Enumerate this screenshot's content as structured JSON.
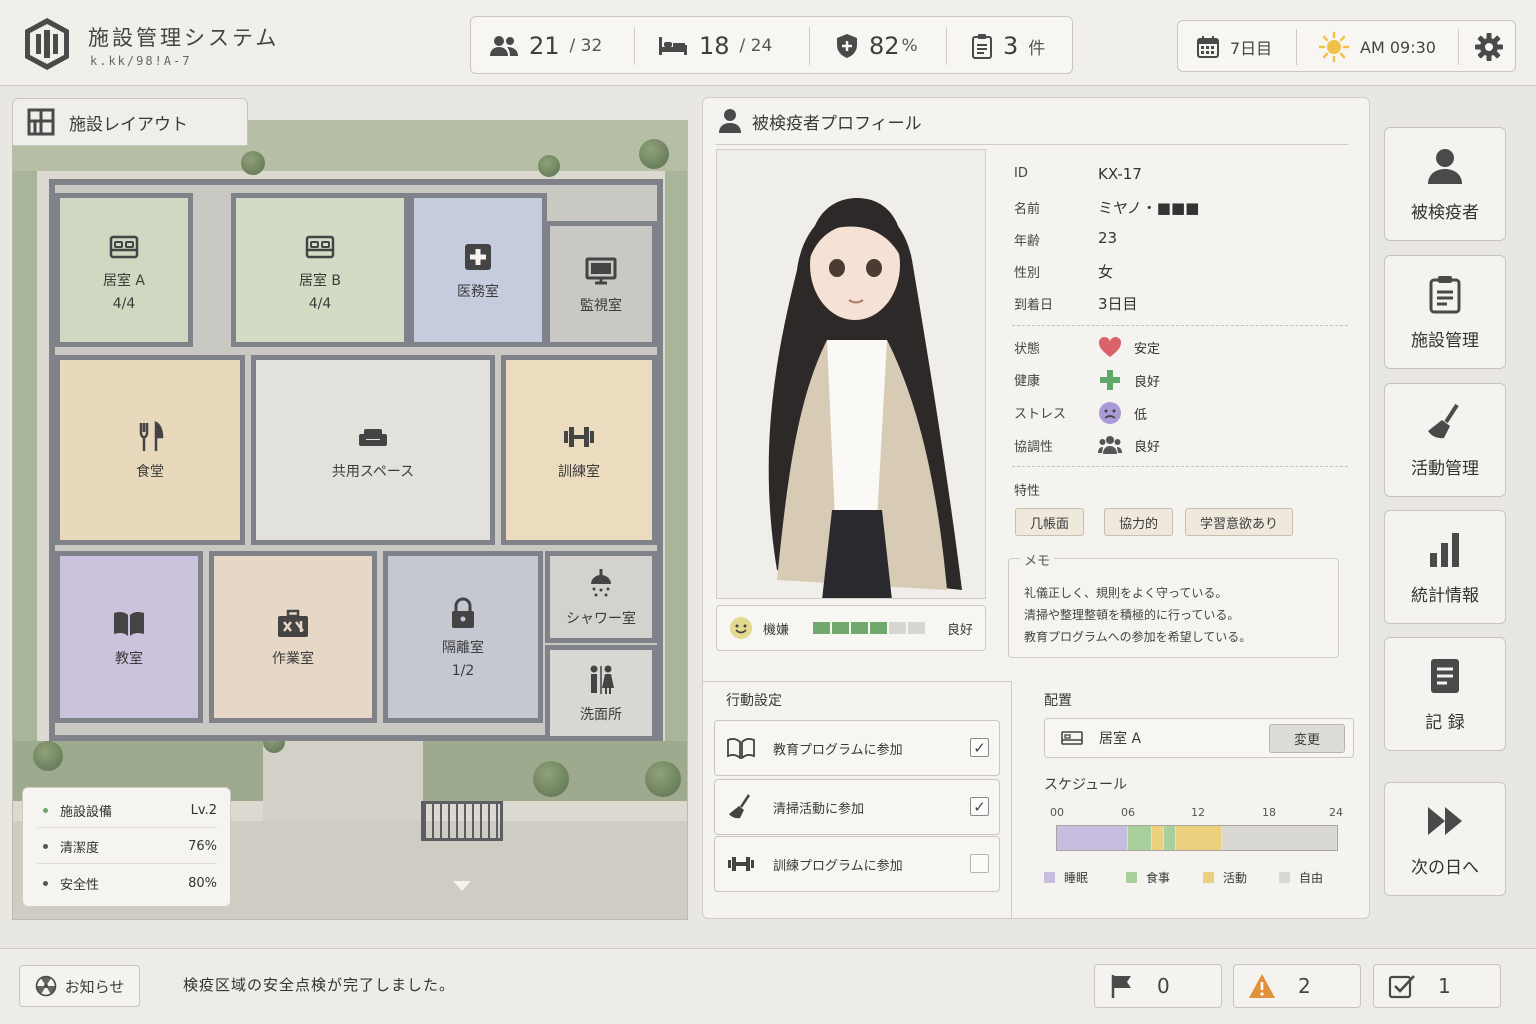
{
  "header": {
    "title": "施設管理システム",
    "subtitle": "k.kk/98!A-7",
    "stats": [
      {
        "icon": "people-icon",
        "value": "21",
        "total": "/ 32"
      },
      {
        "icon": "bed-icon",
        "value": "18",
        "total": "/ 24"
      },
      {
        "icon": "shield-icon",
        "value": "82",
        "total": "%"
      },
      {
        "icon": "clipboard-icon",
        "value": "3",
        "total": "件"
      }
    ],
    "day": "7日目",
    "time": "AM 09:30"
  },
  "facility": {
    "tab_label": "施設レイアウト",
    "rooms": {
      "room_a": {
        "name": "居室 A",
        "count": "4/4"
      },
      "room_b": {
        "name": "居室 B",
        "count": "4/4"
      },
      "medical": {
        "name": "医務室"
      },
      "monitor": {
        "name": "監視室"
      },
      "dining": {
        "name": "食堂"
      },
      "common": {
        "name": "共用スペース"
      },
      "training": {
        "name": "訓練室"
      },
      "classroom": {
        "name": "教室"
      },
      "workshop": {
        "name": "作業室"
      },
      "isolation": {
        "name": "隔離室",
        "count": "1/2"
      },
      "shower": {
        "name": "シャワー室"
      },
      "washroom": {
        "name": "洗面所"
      }
    },
    "legend": [
      {
        "label": "施設設備",
        "value": "Lv.2"
      },
      {
        "label": "清潔度",
        "value": "76%"
      },
      {
        "label": "安全性",
        "value": "80%"
      }
    ]
  },
  "profile": {
    "title": "被検疫者プロフィール",
    "fields": [
      {
        "label": "ID",
        "value": "KX-17"
      },
      {
        "label": "名前",
        "value": "ミヤノ・■■■"
      },
      {
        "label": "年齢",
        "value": "23"
      },
      {
        "label": "性別",
        "value": "女"
      },
      {
        "label": "到着日",
        "value": "3日目"
      }
    ],
    "status": [
      {
        "label": "状態",
        "value": "安定",
        "icon": "heart-icon"
      },
      {
        "label": "健康",
        "value": "良好",
        "icon": "plus-icon"
      },
      {
        "label": "ストレス",
        "value": "低",
        "icon": "frown-face-icon"
      },
      {
        "label": "協調性",
        "value": "良好",
        "icon": "group-icon"
      }
    ],
    "traits_label": "特性",
    "traits": [
      "几帳面",
      "協力的",
      "学習意欲あり"
    ],
    "memo_label": "メモ",
    "memo": [
      "礼儀正しく、規則をよく守っている。",
      "清掃や整理整頓を積極的に行っている。",
      "教育プログラムへの参加を希望している。"
    ],
    "mood": {
      "label": "機嫌",
      "value": "良好",
      "level": 0.7
    }
  },
  "actions": {
    "title": "行動設定",
    "items": [
      {
        "label": "教育プログラムに参加",
        "checked": "✓"
      },
      {
        "label": "清掃活動に参加",
        "checked": "✓"
      },
      {
        "label": "訓練プログラムに参加",
        "checked": ""
      }
    ]
  },
  "placement": {
    "title": "配置",
    "room": "居室 A",
    "change_label": "変更",
    "schedule_title": "スケジュール",
    "ticks": [
      "00",
      "06",
      "12",
      "18",
      "24"
    ],
    "legend": [
      {
        "label": "睡眠",
        "color": "#c6bde0"
      },
      {
        "label": "食事",
        "color": "#a8cf9c"
      },
      {
        "label": "活動",
        "color": "#ebd17e"
      },
      {
        "label": "自由",
        "color": "#dad8d3"
      }
    ]
  },
  "nav": {
    "items": [
      "被検疫者",
      "施設管理",
      "活動管理",
      "統計情報",
      "記 録",
      "次の日へ"
    ]
  },
  "footer": {
    "notice_label": "お知らせ",
    "notice_text": "検疫区域の安全点検が完了しました。",
    "counters": [
      "0",
      "2",
      "1"
    ]
  }
}
